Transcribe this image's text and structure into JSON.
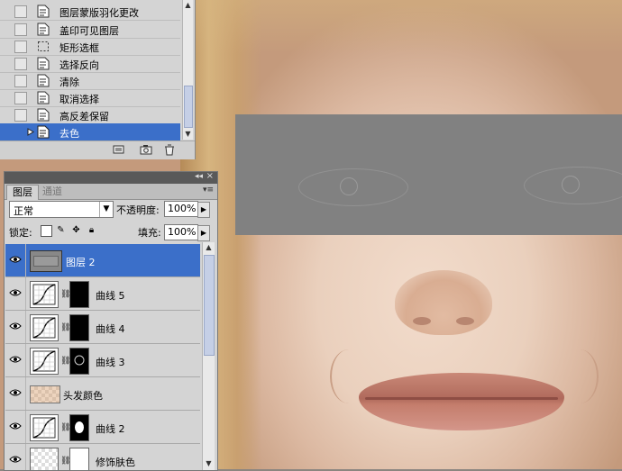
{
  "history_panel": {
    "items": [
      {
        "label": "图层蒙版羽化更改",
        "icon": "document-icon",
        "selected": false
      },
      {
        "label": "盖印可见图层",
        "icon": "document-icon",
        "selected": false
      },
      {
        "label": "矩形选框",
        "icon": "marquee-icon",
        "selected": false
      },
      {
        "label": "选择反向",
        "icon": "document-icon",
        "selected": false
      },
      {
        "label": "清除",
        "icon": "document-icon",
        "selected": false
      },
      {
        "label": "取消选择",
        "icon": "document-icon",
        "selected": false
      },
      {
        "label": "高反差保留",
        "icon": "document-icon",
        "selected": false
      },
      {
        "label": "去色",
        "icon": "document-icon",
        "selected": true
      }
    ],
    "footer_icons": [
      "new-document-icon",
      "snapshot-icon",
      "trash-icon"
    ]
  },
  "layers_panel": {
    "tabs": [
      "图层",
      "通道"
    ],
    "active_tab": "图层",
    "blend_mode": "正常",
    "opacity_label": "不透明度:",
    "opacity_value": "100%",
    "lock_label": "锁定:",
    "fill_label": "填充:",
    "fill_value": "100%",
    "layers": [
      {
        "name": "图层 2",
        "type": "pixel",
        "selected": true
      },
      {
        "name": "曲线 5",
        "type": "curves",
        "selected": false
      },
      {
        "name": "曲线 4",
        "type": "curves",
        "selected": false
      },
      {
        "name": "曲线 3",
        "type": "curves",
        "selected": false
      },
      {
        "name": "头发颜色",
        "type": "pixel",
        "selected": false
      },
      {
        "name": "曲线 2",
        "type": "curves",
        "selected": false
      },
      {
        "name": "修饰肤色",
        "type": "pixel-mask",
        "selected": false
      }
    ]
  },
  "colors": {
    "selection": "#3b6fc9",
    "panel_bg": "#d4d4d4",
    "gray_overlay": "#818181"
  }
}
